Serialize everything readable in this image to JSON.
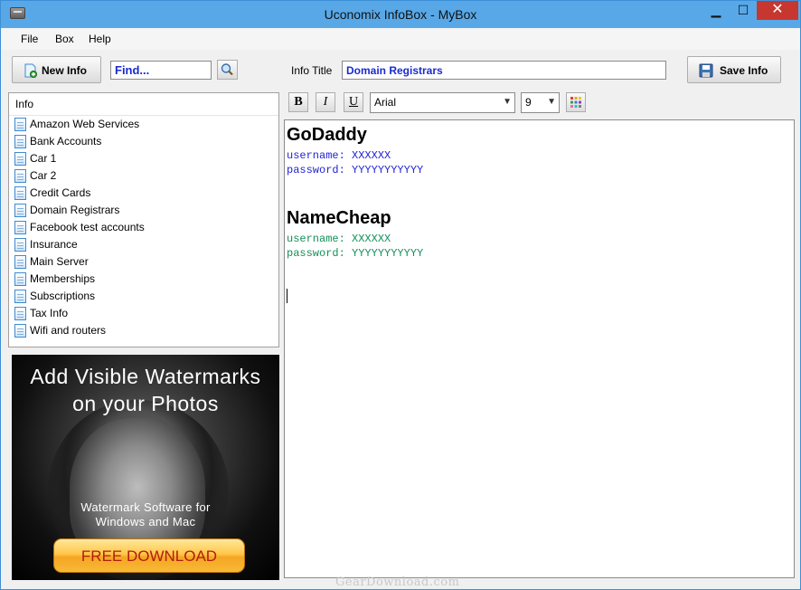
{
  "window": {
    "title": "Uconomix InfoBox - MyBox",
    "min_glyph": "▁",
    "max_glyph": "☐",
    "close_glyph": "✕"
  },
  "menu": [
    "File",
    "Box",
    "Help"
  ],
  "toolbar": {
    "new_info_label": "New Info",
    "find_value": "Find...",
    "info_title_label": "Info Title",
    "info_title_value": "Domain Registrars",
    "save_label": "Save Info"
  },
  "list": {
    "header": "Info",
    "items": [
      "Amazon Web Services",
      "Bank Accounts",
      "Car 1",
      "Car 2",
      "Credit Cards",
      "Domain Registrars",
      "Facebook test accounts",
      "Insurance",
      "Main Server",
      "Memberships",
      "Subscriptions",
      "Tax Info",
      "Wifi and routers"
    ]
  },
  "ad": {
    "headline_1": "Add Visible Watermarks",
    "headline_2": "on your Photos",
    "sub_1": "Watermark Software for",
    "sub_2": "Windows and Mac",
    "button": "FREE DOWNLOAD"
  },
  "format": {
    "bold": "B",
    "italic": "I",
    "underline": "U",
    "font": "Arial",
    "size": "9"
  },
  "editor": {
    "blocks": [
      {
        "heading": "GoDaddy",
        "username": "username: XXXXXX",
        "password": "password: YYYYYYYYYYY",
        "color": "#2323d6"
      },
      {
        "heading": "NameCheap",
        "username": "username: XXXXXX",
        "password": "password: YYYYYYYYYYY",
        "color": "#14905a"
      }
    ]
  },
  "watermark": "GearDownload.com",
  "colors": {
    "titlebar": "#58a8e8",
    "close": "#c7372f",
    "accent_text": "#1a2bcf"
  }
}
